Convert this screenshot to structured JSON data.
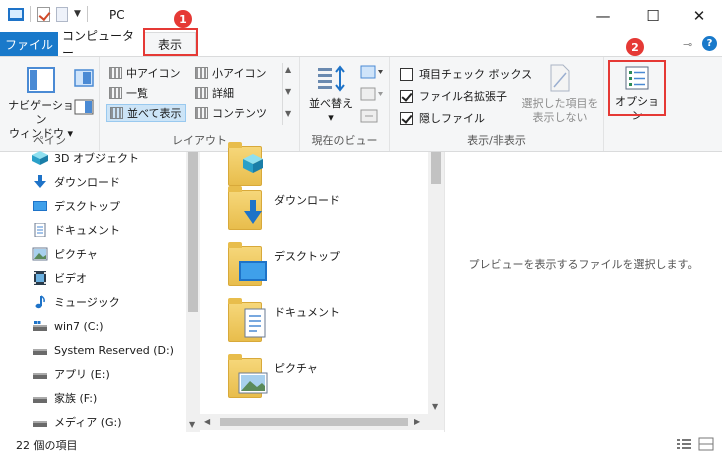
{
  "window": {
    "title": "PC",
    "minimize": "—",
    "maximize": "☐",
    "close": "✕"
  },
  "tabs": {
    "file": "ファイル",
    "computer": "コンピューター",
    "view": "表示"
  },
  "annotations": {
    "badge1": "1",
    "badge2": "2",
    "highlight_color": "#e53935"
  },
  "ribbon": {
    "pane": {
      "label": "ペイン",
      "nav_pane_line1": "ナビゲーション",
      "nav_pane_line2": "ウィンドウ ▾"
    },
    "layout": {
      "label": "レイアウト",
      "items": [
        "中アイコン",
        "小アイコン",
        "一覧",
        "詳細",
        "並べて表示",
        "コンテンツ"
      ],
      "selected": "並べて表示"
    },
    "current_view": {
      "label": "現在のビュー",
      "sort_line1": "並べ替え",
      "sort_line2": "▾"
    },
    "show_hide": {
      "label": "表示/非表示",
      "checkboxes": [
        {
          "label": "項目チェック ボックス",
          "checked": false
        },
        {
          "label": "ファイル名拡張子",
          "checked": true
        },
        {
          "label": "隠しファイル",
          "checked": true
        }
      ],
      "hide_selected_line1": "選択した項目を",
      "hide_selected_line2": "表示しない"
    },
    "options": {
      "label": "オプション"
    }
  },
  "navigation": {
    "items": [
      {
        "label": "3D オブジェクト",
        "icon": "3d-objects-icon"
      },
      {
        "label": "ダウンロード",
        "icon": "download-icon"
      },
      {
        "label": "デスクトップ",
        "icon": "desktop-icon"
      },
      {
        "label": "ドキュメント",
        "icon": "document-icon"
      },
      {
        "label": "ピクチャ",
        "icon": "picture-icon"
      },
      {
        "label": "ビデオ",
        "icon": "video-icon"
      },
      {
        "label": "ミュージック",
        "icon": "music-icon"
      },
      {
        "label": "win7 (C:)",
        "icon": "drive-icon"
      },
      {
        "label": "System Reserved (D:)",
        "icon": "drive-icon"
      },
      {
        "label": "アプリ (E:)",
        "icon": "drive-icon"
      },
      {
        "label": "家族 (F:)",
        "icon": "drive-icon"
      },
      {
        "label": "メディア (G:)",
        "icon": "drive-icon"
      }
    ]
  },
  "files": {
    "items": [
      {
        "label": "",
        "icon": "3d-objects-icon"
      },
      {
        "label": "ダウンロード",
        "icon": "download-icon"
      },
      {
        "label": "デスクトップ",
        "icon": "desktop-icon"
      },
      {
        "label": "ドキュメント",
        "icon": "document-icon"
      },
      {
        "label": "ピクチャ",
        "icon": "picture-icon"
      }
    ]
  },
  "preview": {
    "text": "プレビューを表示するファイルを選択します。"
  },
  "status": {
    "count": "22 個の項目"
  }
}
